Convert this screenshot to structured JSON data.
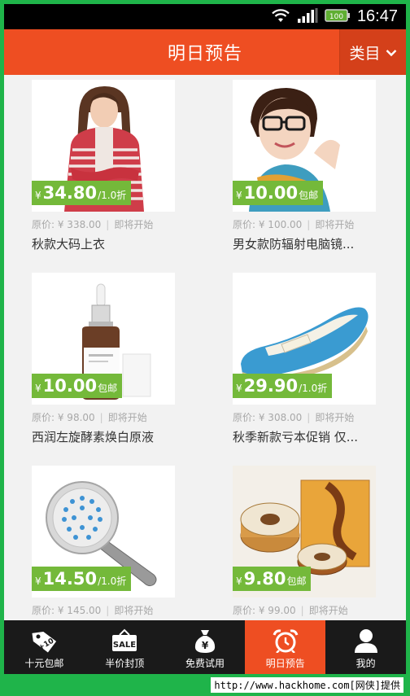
{
  "status_bar": {
    "time": "16:47",
    "battery": "100"
  },
  "header": {
    "title": "明日预告",
    "category_label": "类目"
  },
  "products": [
    {
      "price": "34.80",
      "yen": "¥",
      "suffix": "/1.0折",
      "original": "原价: ¥ 338.00",
      "status": "即将开始",
      "name": "秋款大码上衣"
    },
    {
      "price": "10.00",
      "yen": "¥",
      "suffix": "包邮",
      "original": "原价: ¥ 100.00",
      "status": "即将开始",
      "name": "男女款防辐射电脑镜..."
    },
    {
      "price": "10.00",
      "yen": "¥",
      "suffix": "包邮",
      "original": "原价: ¥ 98.00",
      "status": "即将开始",
      "name": "西润左旋酵素焕白原液"
    },
    {
      "price": "29.90",
      "yen": "¥",
      "suffix": "/1.0折",
      "original": "原价: ¥ 308.00",
      "status": "即将开始",
      "name": "秋季新款亏本促销 仅..."
    },
    {
      "price": "14.50",
      "yen": "¥",
      "suffix": "/1.0折",
      "original": "原价: ¥ 145.00",
      "status": "即将开始",
      "name": ""
    },
    {
      "price": "9.80",
      "yen": "¥",
      "suffix": "包邮",
      "original": "原价: ¥ 99.00",
      "status": "即将开始",
      "name": ""
    }
  ],
  "tabs": [
    {
      "label": "十元包邮",
      "icon": "tag-icon",
      "badge": "+10",
      "active": false
    },
    {
      "label": "半价封顶",
      "icon": "sale-sign-icon",
      "badge": "SALE",
      "active": false
    },
    {
      "label": "免费试用",
      "icon": "money-bag-icon",
      "badge": "¥",
      "active": false
    },
    {
      "label": "明日预告",
      "icon": "alarm-clock-icon",
      "active": true
    },
    {
      "label": "我的",
      "icon": "user-icon",
      "active": false
    }
  ],
  "watermark": "http://www.hackhome.com[网侠]提供",
  "colors": {
    "header": "#ee4e22",
    "price_tag": "#74b93a",
    "tab_bar": "#1a1a1a",
    "frame": "#1fb44a"
  }
}
